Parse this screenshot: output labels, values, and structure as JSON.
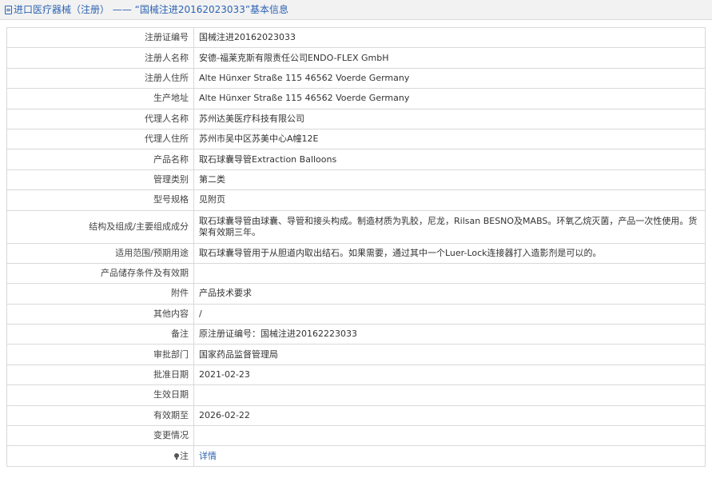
{
  "header": {
    "title": "进口医疗器械（注册） —— “国械注进20162023033”基本信息"
  },
  "rows": [
    {
      "label": "注册证编号",
      "value": "国械注进20162023033"
    },
    {
      "label": "注册人名称",
      "value": "安德-福莱克斯有限责任公司ENDO-FLEX GmbH"
    },
    {
      "label": "注册人住所",
      "value": "Alte Hünxer Straße 115 46562 Voerde Germany"
    },
    {
      "label": "生产地址",
      "value": "Alte Hünxer Straße 115 46562 Voerde Germany"
    },
    {
      "label": "代理人名称",
      "value": "苏州达美医疗科技有限公司"
    },
    {
      "label": "代理人住所",
      "value": "苏州市吴中区苏美中心A幢12E"
    },
    {
      "label": "产品名称",
      "value": "取石球囊导管Extraction Balloons"
    },
    {
      "label": "管理类别",
      "value": "第二类"
    },
    {
      "label": "型号规格",
      "value": "见附页"
    },
    {
      "label": "结构及组成/主要组成成分",
      "value": "取石球囊导管由球囊、导管和接头构成。制造材质为乳胶，尼龙，Rilsan BESNO及MABS。环氧乙烷灭菌，产品一次性使用。货架有效期三年。"
    },
    {
      "label": "适用范围/预期用途",
      "value": "取石球囊导管用于从胆道内取出结石。如果需要，通过其中一个Luer-Lock连接器打入造影剂是可以的。"
    },
    {
      "label": "产品储存条件及有效期",
      "value": ""
    },
    {
      "label": "附件",
      "value": "产品技术要求"
    },
    {
      "label": "其他内容",
      "value": "/"
    },
    {
      "label": "备注",
      "value": "原注册证编号：国械注进20162223033"
    },
    {
      "label": "审批部门",
      "value": "国家药品监督管理局"
    },
    {
      "label": "批准日期",
      "value": "2021-02-23"
    },
    {
      "label": "生效日期",
      "value": ""
    },
    {
      "label": "有效期至",
      "value": "2026-02-22"
    },
    {
      "label": "变更情况",
      "value": ""
    }
  ],
  "note": {
    "label": "注",
    "link": "详情"
  }
}
